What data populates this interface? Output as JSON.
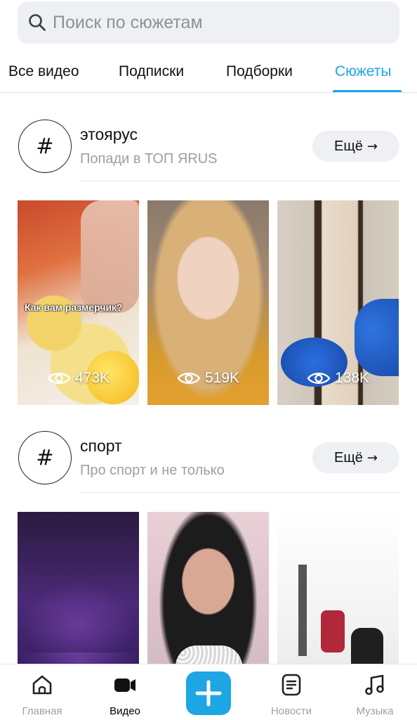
{
  "search": {
    "placeholder": "Поиск по сюжетам"
  },
  "tabs": [
    {
      "label": "Все видео",
      "active": false
    },
    {
      "label": "Подписки",
      "active": false
    },
    {
      "label": "Подборки",
      "active": false
    },
    {
      "label": "Сюжеты",
      "active": true
    }
  ],
  "sections": [
    {
      "hash": "#",
      "title": "этоярус",
      "subtitle": "Попади в ТОП ЯRUS",
      "more_label": "Ещё",
      "more_arrow": "→",
      "videos": [
        {
          "views": "473K",
          "caption": "Как вам размерчик?"
        },
        {
          "views": "519K"
        },
        {
          "views": "138K"
        }
      ]
    },
    {
      "hash": "#",
      "title": "спорт",
      "subtitle": "Про спорт и не только",
      "more_label": "Ещё",
      "more_arrow": "→",
      "videos": [
        {},
        {},
        {}
      ]
    }
  ],
  "bottom_nav": [
    {
      "label": "Главная",
      "icon": "home-icon",
      "active": false
    },
    {
      "label": "Видео",
      "icon": "video-camera-icon",
      "active": true
    },
    {
      "label": "",
      "icon": "plus-icon",
      "active": false
    },
    {
      "label": "Новости",
      "icon": "news-icon",
      "active": false
    },
    {
      "label": "Музыка",
      "icon": "music-note-icon",
      "active": false
    }
  ],
  "colors": {
    "accent": "#1ea5e3",
    "muted": "#9aa0a6",
    "chip_bg": "#eef0f3"
  }
}
